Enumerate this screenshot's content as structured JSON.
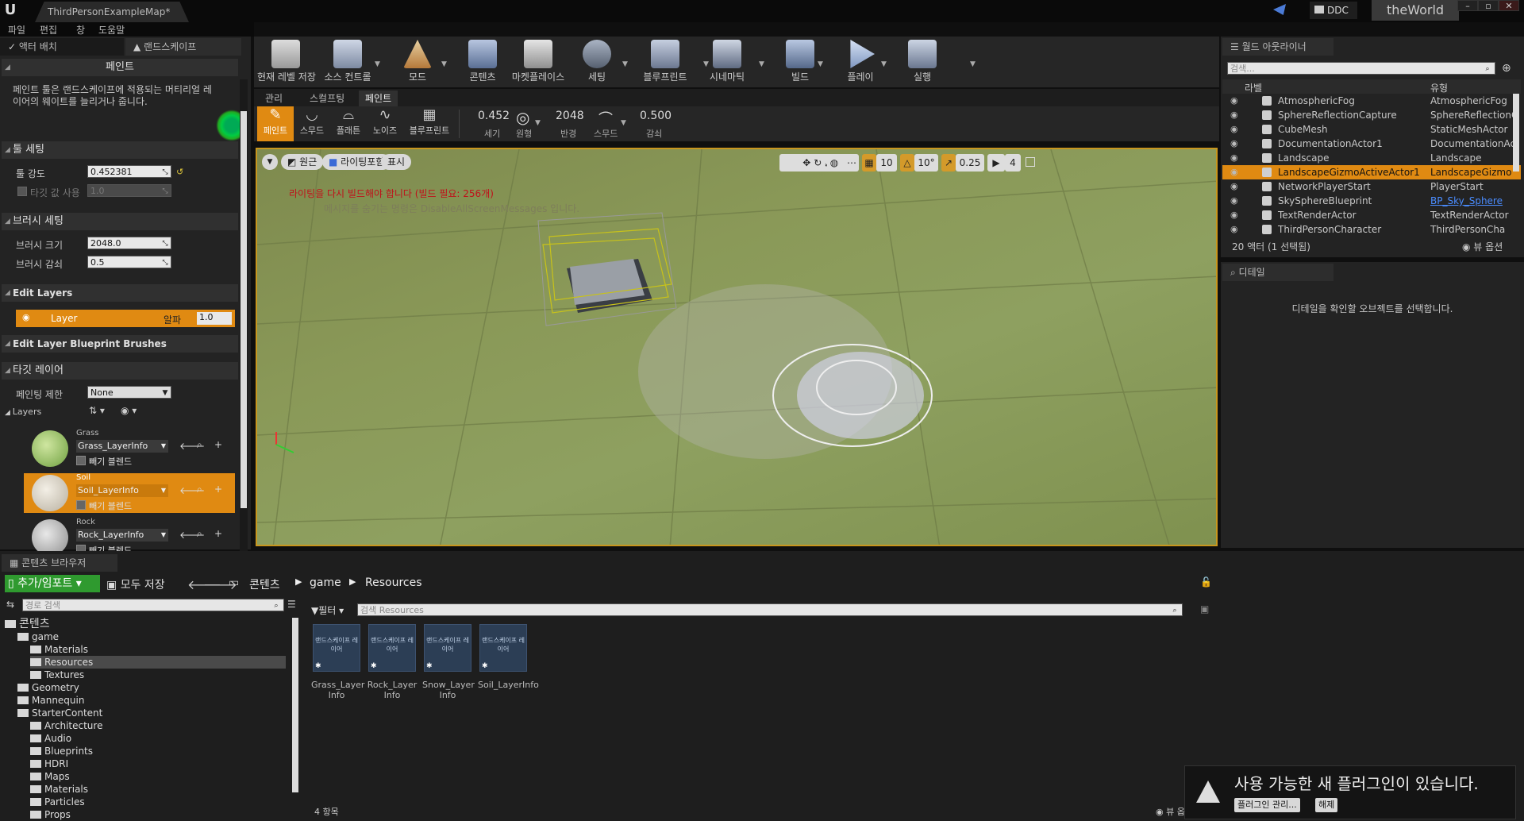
{
  "titlebar": {
    "app_logo": "U",
    "document_tab": "ThirdPersonExampleMap*",
    "ddc_label": "DDC",
    "world_label": "theWorld"
  },
  "menubar": {
    "items": [
      "파일",
      "편집",
      "창",
      "도움말"
    ]
  },
  "left_panel": {
    "tabs": [
      "액터 배치",
      "랜드스케이프"
    ],
    "paint_header": "페인트",
    "description": "페인트 툴은 랜드스케이프에 적용되는 머티리얼 레이어의 웨이트를 늘리거나 줍니다.",
    "tool_settings_header": "툴 세팅",
    "tool_strength_label": "툴 강도",
    "tool_strength_value": "0.452381",
    "target_value_label": "타깃 값 사용",
    "target_value_value": "1.0",
    "brush_settings_header": "브러시 세팅",
    "brush_size_label": "브러시 크기",
    "brush_size_value": "2048.0",
    "brush_falloff_label": "브러시 감쇠",
    "brush_falloff_value": "0.5",
    "edit_layers_header": "Edit Layers",
    "layer_name": "Layer",
    "layer_alpha_label": "알파",
    "layer_alpha_value": "1.0",
    "blueprint_brushes_header": "Edit Layer Blueprint Brushes",
    "target_layers_header": "타깃 레이어",
    "paint_restriction_label": "페인팅 제한",
    "paint_restriction_value": "None",
    "layers_label": "Layers",
    "subtract_blend_label": "빼기 블렌드",
    "layers": [
      {
        "name": "Grass",
        "info": "Grass_LayerInfo",
        "selected": false
      },
      {
        "name": "Soil",
        "info": "Soil_LayerInfo",
        "selected": true
      },
      {
        "name": "Rock",
        "info": "Rock_LayerInfo",
        "selected": false
      }
    ]
  },
  "toolbar": {
    "save": "현재 레벨 저장",
    "source_control": "소스 컨트롤",
    "modes": "모드",
    "content": "콘텐츠",
    "marketplace": "마켓플레이스",
    "settings": "세팅",
    "blueprint": "블루프린트",
    "cinematics": "시네마틱",
    "build": "빌드",
    "play": "플레이",
    "launch": "실행"
  },
  "mode_tabs": [
    "관리",
    "스컬프팅",
    "페인트"
  ],
  "paint_tools": {
    "paint": "페인트",
    "smooth": "스무드",
    "flatten": "플래튼",
    "noise": "노이즈",
    "blueprint": "블루프린트",
    "strength_value": "0.452",
    "strength_label": "세기",
    "shape_label": "원형",
    "radius_value": "2048",
    "radius_label": "반경",
    "smooth_label": "스무드",
    "falloff_value": "0.500",
    "falloff_label": "감쇠"
  },
  "viewport": {
    "perspective_btn": "원근",
    "lit_btn": "라이팅포함",
    "show_btn": "표시",
    "grid_snap": "10",
    "rot_snap": "10°",
    "scale_snap": "0.25",
    "cam_speed": "4",
    "lighting_msg": "라이팅을 다시 빌드해야 합니다 (빌드 필요: 256개)",
    "hide_msg": "메시지를 숨기는 명령은 DisableAllScreenMessages 입니다."
  },
  "outliner": {
    "tab": "월드 아웃라이너",
    "search_placeholder": "검색...",
    "col_label": "라벨",
    "col_type": "유형",
    "rows": [
      {
        "name": "AtmosphericFog",
        "type": "AtmosphericFog",
        "selected": false
      },
      {
        "name": "SphereReflectionCapture",
        "type": "SphereReflectionC",
        "selected": false
      },
      {
        "name": "CubeMesh",
        "type": "StaticMeshActor",
        "selected": false
      },
      {
        "name": "DocumentationActor1",
        "type": "DocumentationAc",
        "selected": false
      },
      {
        "name": "Landscape",
        "type": "Landscape",
        "selected": false
      },
      {
        "name": "LandscapeGizmoActiveActor1",
        "type": "LandscapeGizmo",
        "selected": true
      },
      {
        "name": "NetworkPlayerStart",
        "type": "PlayerStart",
        "selected": false
      },
      {
        "name": "SkySphereBlueprint",
        "type": "BP_Sky_Sphere",
        "selected": false
      },
      {
        "name": "TextRenderActor",
        "type": "TextRenderActor",
        "selected": false
      },
      {
        "name": "ThirdPersonCharacter",
        "type": "ThirdPersonCha",
        "selected": false
      }
    ],
    "count": "20 액터 (1 선택됨)",
    "view_options": "뷰 옵션"
  },
  "details": {
    "tab": "디테일",
    "empty_msg": "디테일을 확인할 오브젝트를 선택합니다."
  },
  "content_browser": {
    "tab": "콘텐츠 브라우저",
    "add_import": "추가/임포트",
    "save_all": "모두 저장",
    "path": [
      "콘텐츠",
      "game",
      "Resources"
    ],
    "path_search_placeholder": "경로 검색",
    "filter_label": "필터",
    "search_placeholder": "검색 Resources",
    "tree": [
      {
        "label": "콘텐츠",
        "indent": 0,
        "selected": false
      },
      {
        "label": "game",
        "indent": 1,
        "selected": false
      },
      {
        "label": "Materials",
        "indent": 2,
        "selected": false
      },
      {
        "label": "Resources",
        "indent": 2,
        "selected": true
      },
      {
        "label": "Textures",
        "indent": 2,
        "selected": false
      },
      {
        "label": "Geometry",
        "indent": 1,
        "selected": false
      },
      {
        "label": "Mannequin",
        "indent": 1,
        "selected": false
      },
      {
        "label": "StarterContent",
        "indent": 1,
        "selected": false
      },
      {
        "label": "Architecture",
        "indent": 2,
        "selected": false
      },
      {
        "label": "Audio",
        "indent": 2,
        "selected": false
      },
      {
        "label": "Blueprints",
        "indent": 2,
        "selected": false
      },
      {
        "label": "HDRI",
        "indent": 2,
        "selected": false
      },
      {
        "label": "Maps",
        "indent": 2,
        "selected": false
      },
      {
        "label": "Materials",
        "indent": 2,
        "selected": false
      },
      {
        "label": "Particles",
        "indent": 2,
        "selected": false
      },
      {
        "label": "Props",
        "indent": 2,
        "selected": false
      }
    ],
    "asset_thumb_label": "랜드스케이프 레이어",
    "assets": [
      {
        "label": "Grass_Layer Info"
      },
      {
        "label": "Rock_Layer Info"
      },
      {
        "label": "Snow_Layer Info"
      },
      {
        "label": "Soil_LayerInfo"
      }
    ],
    "item_count": "4 항목",
    "view_options": "뷰 옵션"
  },
  "toast": {
    "message": "사용 가능한 새 플러그인이 있습니다.",
    "manage_btn": "플러그인 관리...",
    "dismiss_btn": "해제"
  },
  "colors": {
    "accent": "#e08a12",
    "panel": "#232323",
    "background": "#0f0f0f"
  }
}
